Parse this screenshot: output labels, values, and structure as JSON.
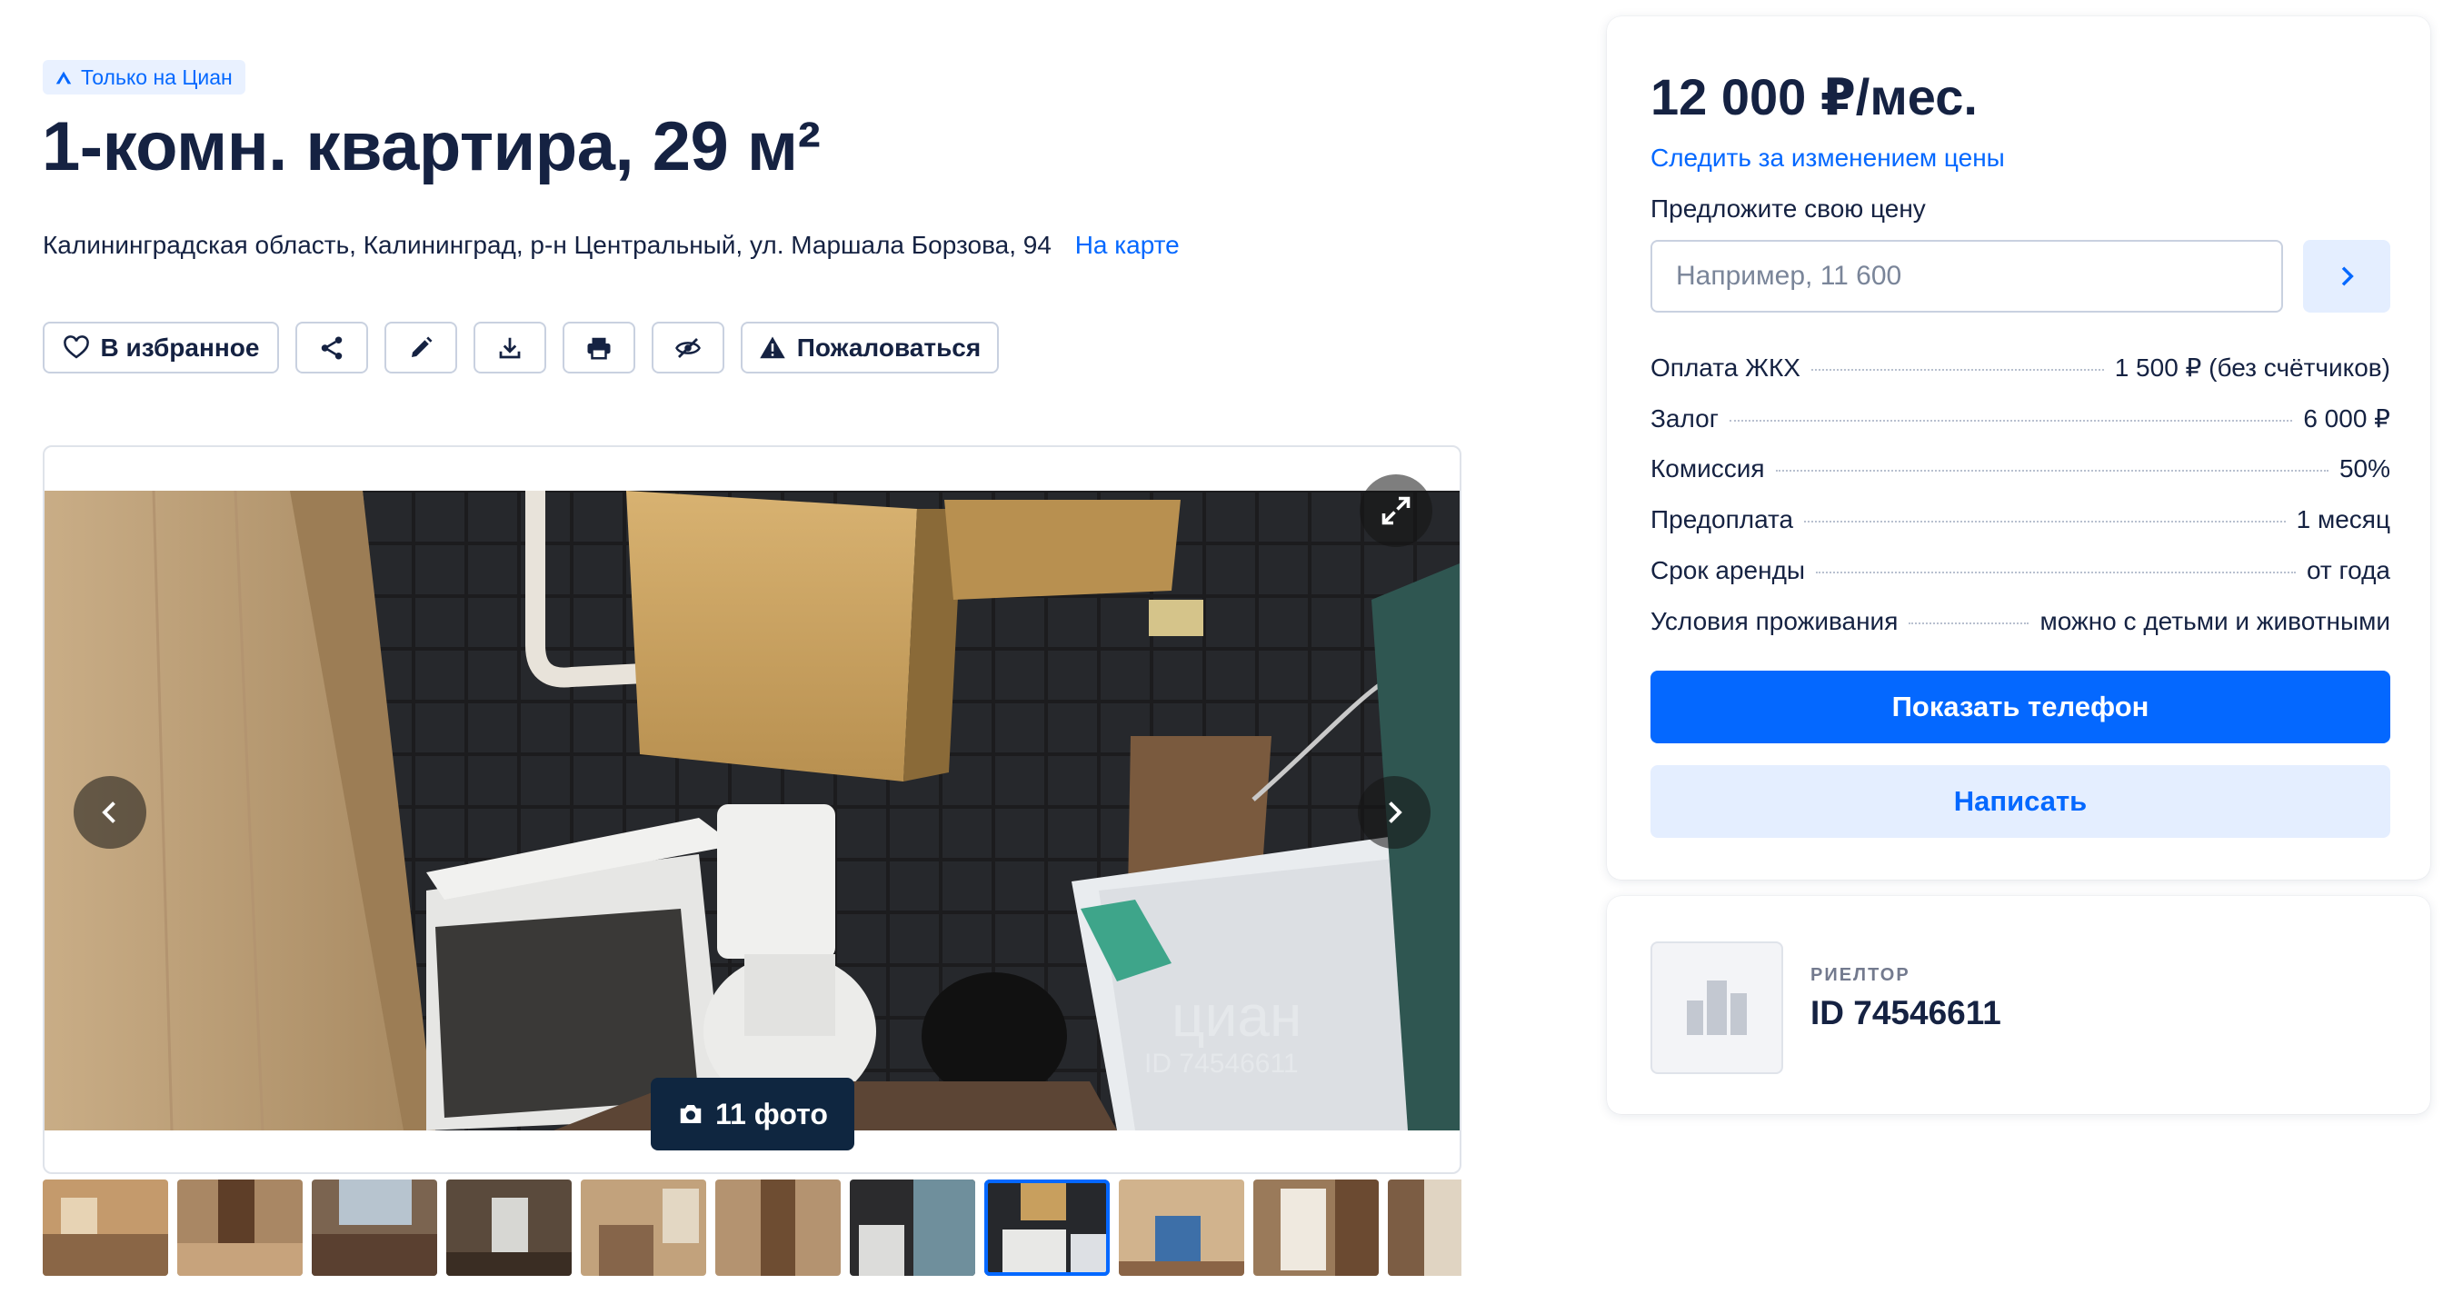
{
  "badge": {
    "label": "Только на Циан",
    "icon": "cian-logo-icon",
    "color": "#0468ff"
  },
  "title": "1-комн. квартира, 29 м²",
  "address": {
    "text": "Калининградская область, Калининград, р-н Центральный, ул. Маршала Борзова, 94",
    "map_link": "На карте"
  },
  "actions": {
    "favorite": "В избранное",
    "share_icon": "share-icon",
    "edit_icon": "pencil-icon",
    "download_icon": "download-icon",
    "print_icon": "printer-icon",
    "hide_icon": "eye-off-icon",
    "report": "Пожаловаться"
  },
  "gallery": {
    "photo_count": "11 фото",
    "watermark": "циан",
    "watermark_id": "ID 74546611",
    "active_thumb_index": 7,
    "thumb_count_visible": 11
  },
  "price_card": {
    "price": "12 000 ₽/мес.",
    "watch_link": "Следить за изменением цены",
    "offer_label": "Предложите свою цену",
    "offer_placeholder": "Например, 11 600",
    "terms": [
      {
        "label": "Оплата ЖКХ",
        "value": "1 500 ₽ (без счётчиков)"
      },
      {
        "label": "Залог",
        "value": "6 000 ₽"
      },
      {
        "label": "Комиссия",
        "value": "50%"
      },
      {
        "label": "Предоплата",
        "value": "1 месяц"
      },
      {
        "label": "Срок аренды",
        "value": "от года"
      },
      {
        "label": "Условия проживания",
        "value": "можно с детьми и животными"
      }
    ],
    "show_phone": "Показать телефон",
    "write": "Написать",
    "accent": "#0468ff"
  },
  "agent": {
    "role": "РИЕЛТОР",
    "id": "ID 74546611"
  }
}
